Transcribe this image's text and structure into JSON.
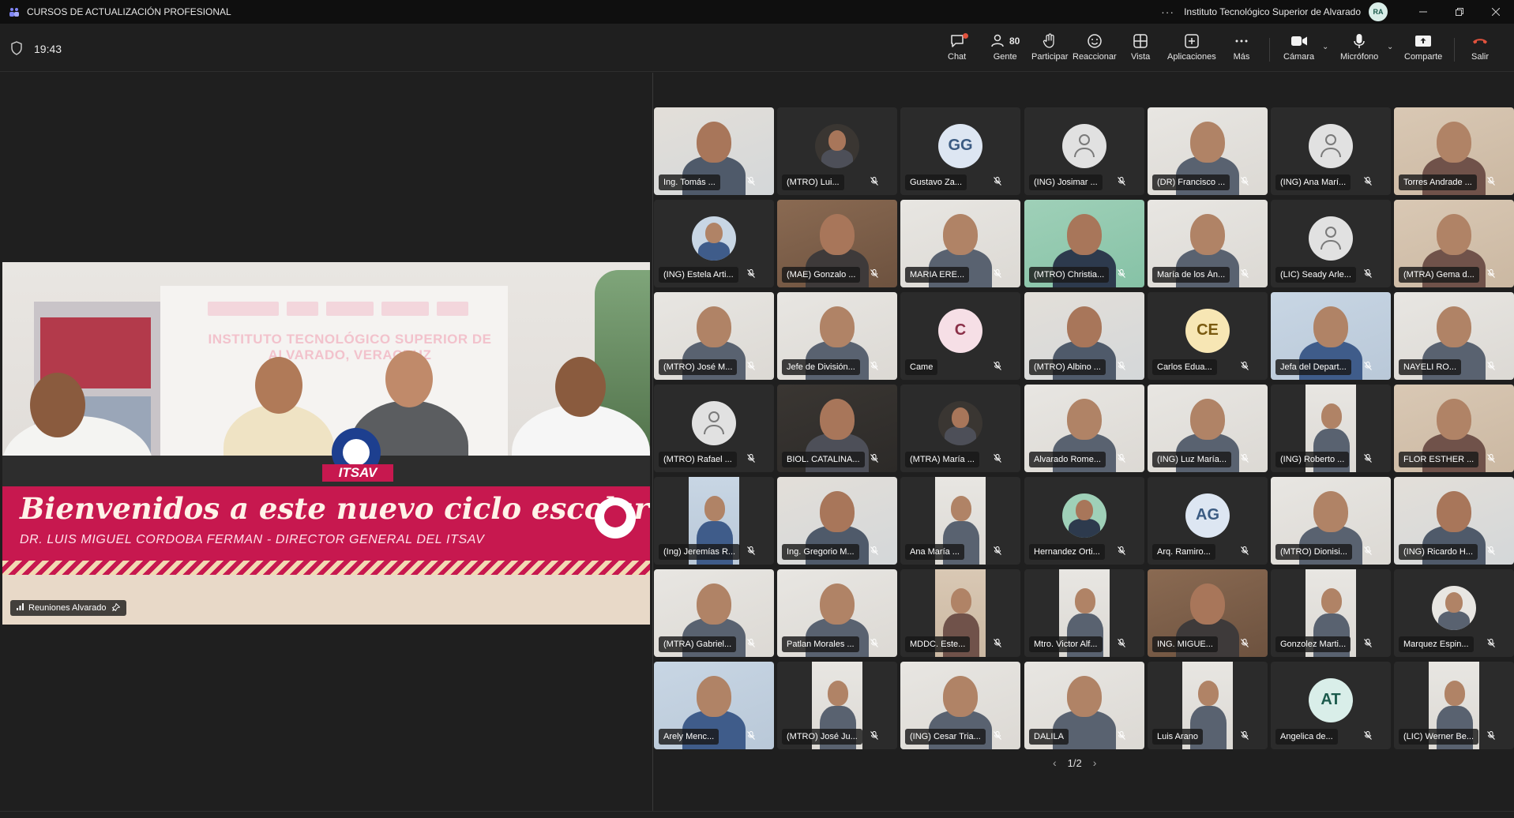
{
  "window": {
    "title": "CURSOS DE ACTUALIZACIÓN PROFESIONAL",
    "more_label": "···",
    "organization": "Instituto Tecnológico Superior de Alvarado",
    "user_initials": "RA"
  },
  "meeting": {
    "elapsed_time": "19:43"
  },
  "toolbar": {
    "chat": "Chat",
    "people": "Gente",
    "people_count": "80",
    "raise": "Participar",
    "react": "Reaccionar",
    "view": "Vista",
    "apps": "Aplicaciones",
    "more": "Más",
    "camera": "Cámara",
    "mic": "Micrófono",
    "share": "Comparte",
    "leave": "Salir"
  },
  "main_video": {
    "headline": "Bienvenidos a este nuevo ciclo escolar",
    "subline": "DR. LUIS MIGUEL CORDOBA FERMAN - DIRECTOR GENERAL DEL ITSAV",
    "backdrop_text": "INSTITUTO TECNOLÓGICO SUPERIOR DE ALVARADO, VERACRUZ",
    "logo_text": "ITSAV",
    "participant_name": "Reuniones Alvarado"
  },
  "colors": {
    "accent": "#c7184f",
    "teams_purple": "#7f85f5",
    "leave_red": "#e0523d"
  },
  "participants": [
    {
      "name": "Ing. Tomás ...",
      "type": "photo",
      "tone": "office"
    },
    {
      "name": "(MTRO) Lui...",
      "type": "picavatar",
      "tone": "dark"
    },
    {
      "name": "Gustavo Za...",
      "type": "initials",
      "initials": "GG",
      "color": "#dde6f2",
      "text": "#3b5b82"
    },
    {
      "name": "(ING) Josimar ...",
      "type": "generic"
    },
    {
      "name": "(DR) Francisco ...",
      "type": "photo",
      "tone": "bright"
    },
    {
      "name": "(ING) Ana Marí...",
      "type": "generic"
    },
    {
      "name": "Torres Andrade ...",
      "type": "photo",
      "tone": "warm"
    },
    {
      "name": "(ING) Estela Arti...",
      "type": "picavatar",
      "tone": "blue"
    },
    {
      "name": "(MAE) Gonzalo ...",
      "type": "photo",
      "tone": "brown"
    },
    {
      "name": "MARIA ERE...",
      "type": "photo",
      "tone": "bright"
    },
    {
      "name": "(MTRO) Christia...",
      "type": "photo",
      "tone": "green"
    },
    {
      "name": "María de los Án...",
      "type": "photo",
      "tone": "bright"
    },
    {
      "name": "(LIC) Seady Arle...",
      "type": "generic"
    },
    {
      "name": "(MTRA) Gema d...",
      "type": "photo",
      "tone": "warm"
    },
    {
      "name": "(MTRO) José M...",
      "type": "photo",
      "tone": "bright"
    },
    {
      "name": "Jefe de División...",
      "type": "photo",
      "tone": "bright"
    },
    {
      "name": "Came",
      "type": "initials",
      "initials": "C",
      "color": "#f6dfe6",
      "text": "#8a3048"
    },
    {
      "name": "(MTRO) Albino ...",
      "type": "photo",
      "tone": "office"
    },
    {
      "name": "Carlos Edua...",
      "type": "initials",
      "initials": "CE",
      "color": "#f7e6b4",
      "text": "#7a5a10"
    },
    {
      "name": "Jefa del Depart...",
      "type": "photo",
      "tone": "blue"
    },
    {
      "name": "NAYELI RO...",
      "type": "photo",
      "tone": "bright"
    },
    {
      "name": "(MTRO) Rafael ...",
      "type": "generic"
    },
    {
      "name": "BIOL. CATALINA...",
      "type": "photo",
      "tone": "dark"
    },
    {
      "name": "(MTRA) María ...",
      "type": "picavatar",
      "tone": "dark"
    },
    {
      "name": "Alvarado Rome...",
      "type": "photo",
      "tone": "bright"
    },
    {
      "name": "(ING) Luz María...",
      "type": "photo",
      "tone": "bright"
    },
    {
      "name": "(ING) Roberto ...",
      "type": "strip",
      "tone": "bright"
    },
    {
      "name": "FLOR ESTHER ...",
      "type": "photo",
      "tone": "warm"
    },
    {
      "name": "(Ing) Jeremías R...",
      "type": "strip",
      "tone": "blue"
    },
    {
      "name": "Ing. Gregorio M...",
      "type": "photo",
      "tone": "office"
    },
    {
      "name": "Ana María ...",
      "type": "strip",
      "tone": "bright"
    },
    {
      "name": "Hernandez Orti...",
      "type": "picavatar",
      "tone": "green"
    },
    {
      "name": "Arq. Ramiro...",
      "type": "initials",
      "initials": "AG",
      "color": "#dde6f2",
      "text": "#3b5b82"
    },
    {
      "name": "(MTRO) Dionisi...",
      "type": "photo",
      "tone": "bright"
    },
    {
      "name": "(ING) Ricardo H...",
      "type": "photo",
      "tone": "office"
    },
    {
      "name": "(MTRA) Gabriel...",
      "type": "photo",
      "tone": "bright"
    },
    {
      "name": "Patlan Morales ...",
      "type": "photo",
      "tone": "bright"
    },
    {
      "name": "MDDC. Este...",
      "type": "strip",
      "tone": "warm"
    },
    {
      "name": "Mtro. Victor Alf...",
      "type": "strip",
      "tone": "bright"
    },
    {
      "name": "ING. MIGUE...",
      "type": "photo",
      "tone": "brown"
    },
    {
      "name": "Gonzolez Marti...",
      "type": "strip",
      "tone": "bright"
    },
    {
      "name": "Marquez Espin...",
      "type": "picavatar",
      "tone": "bright"
    },
    {
      "name": "Arely Menc...",
      "type": "photo",
      "tone": "blue"
    },
    {
      "name": "(MTRO) José Ju...",
      "type": "strip",
      "tone": "bright"
    },
    {
      "name": "(ING) Cesar Tria...",
      "type": "photo",
      "tone": "bright"
    },
    {
      "name": "DALILA",
      "type": "photo",
      "tone": "bright"
    },
    {
      "name": "Luis Arano",
      "type": "strip",
      "tone": "bright"
    },
    {
      "name": "Angelica de...",
      "type": "initials",
      "initials": "AT",
      "color": "#d9eee9",
      "text": "#1b5a4c"
    },
    {
      "name": "(LIC) Werner Be...",
      "type": "strip",
      "tone": "bright"
    }
  ],
  "pager": {
    "label": "1/2"
  }
}
